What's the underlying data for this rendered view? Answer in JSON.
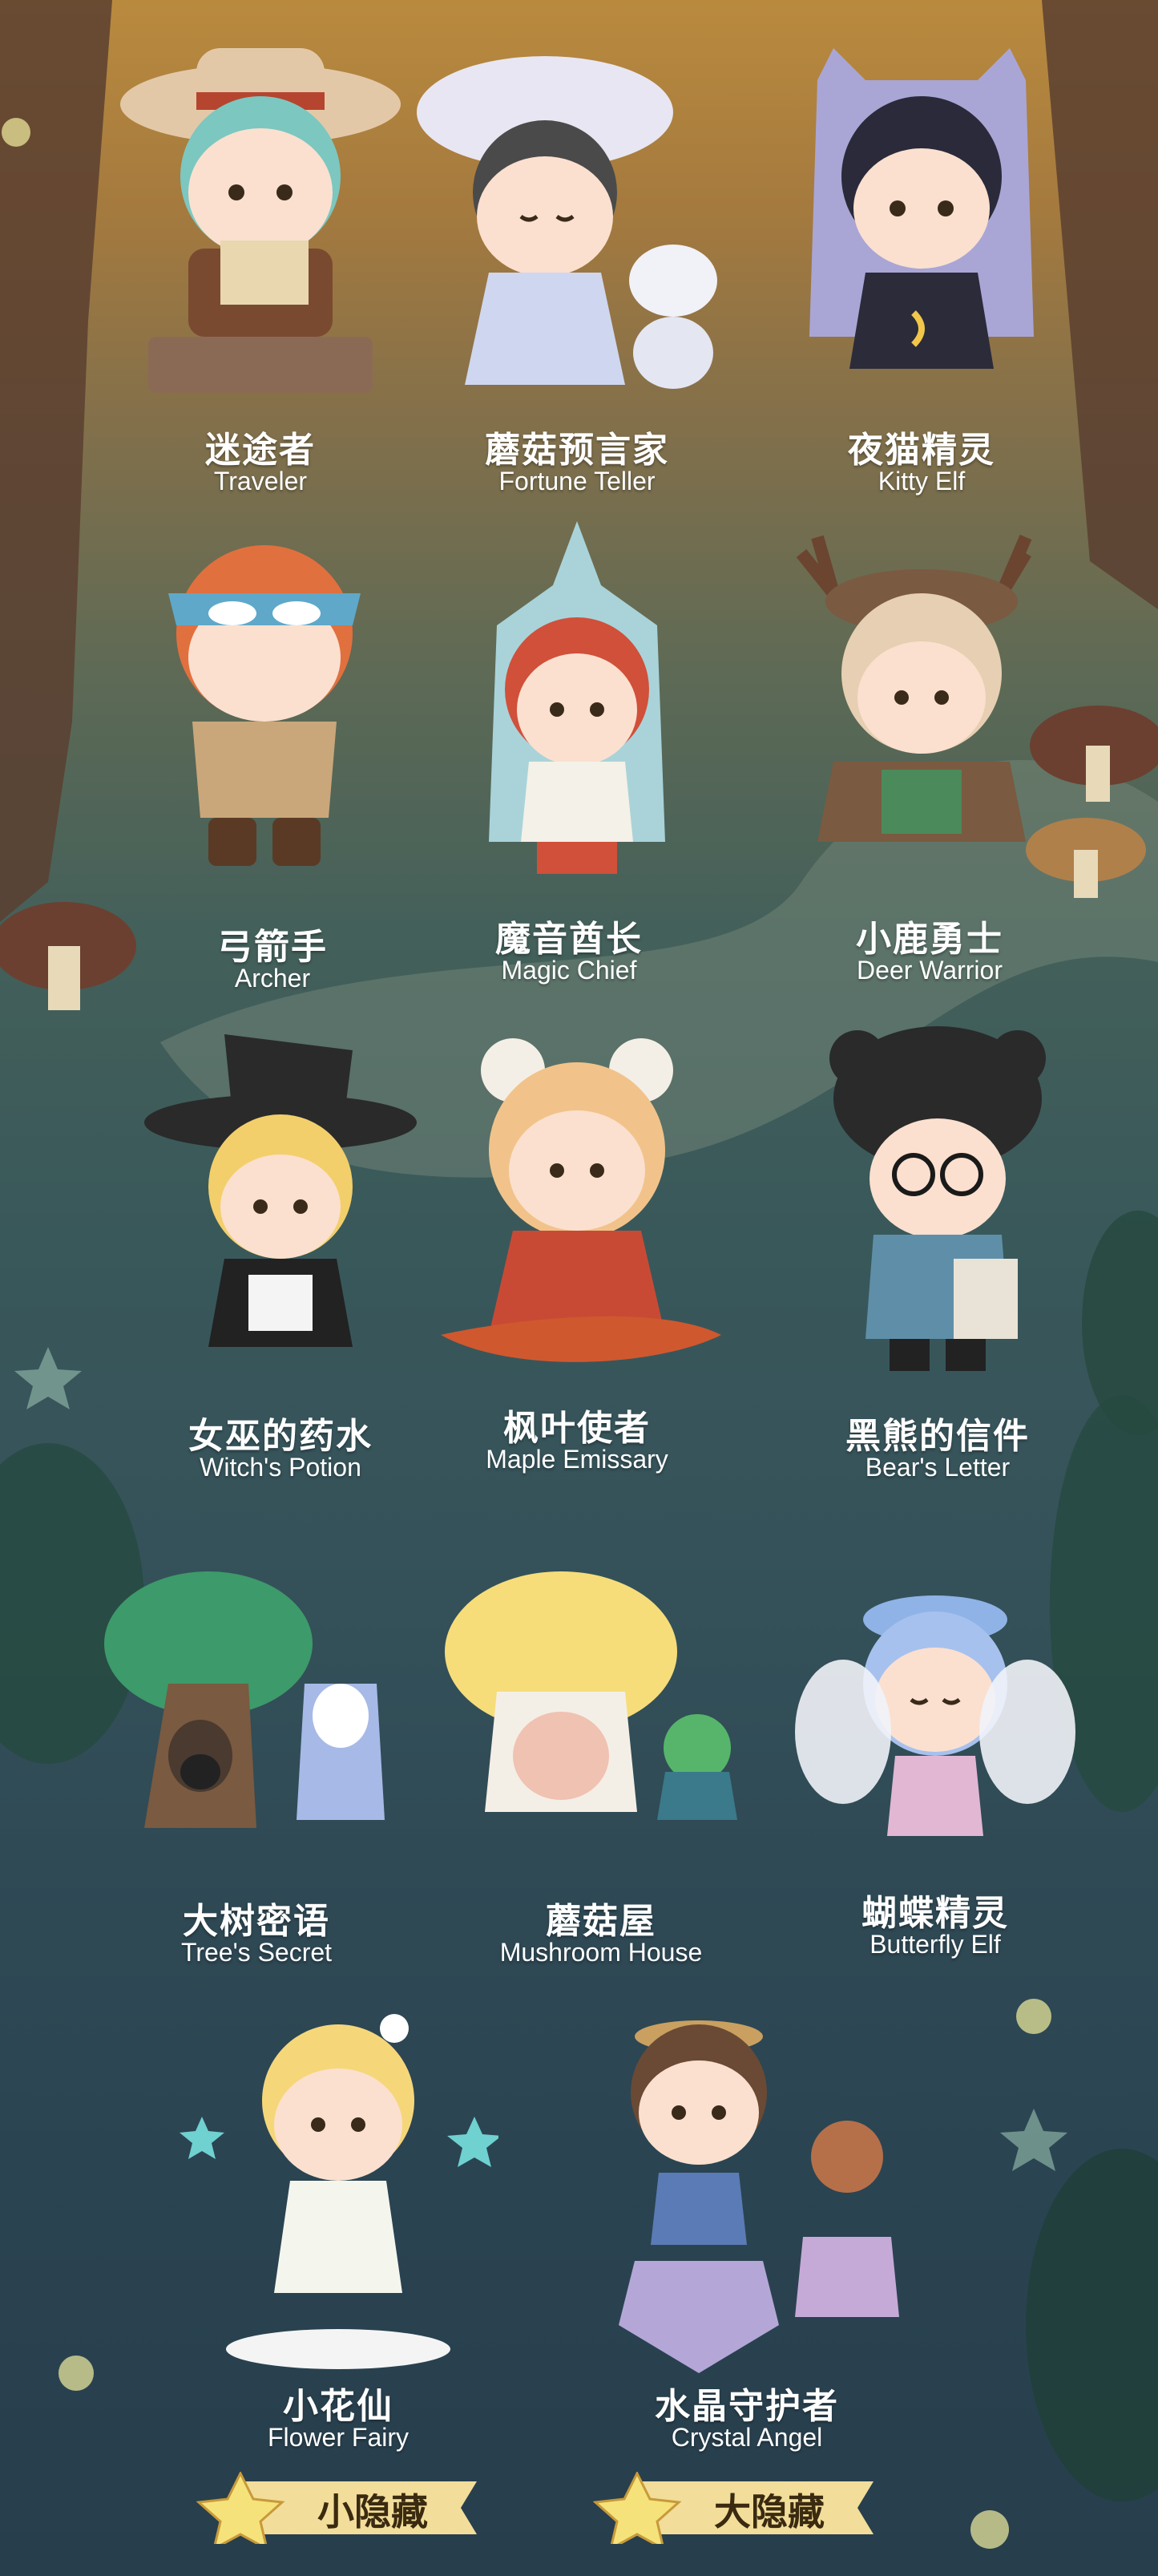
{
  "theme": {
    "label_color": "#ffffff",
    "badge_color": "#f2dd9a",
    "badge_star_color": "#f6e27a"
  },
  "figures": [
    {
      "cn": "迷途者",
      "en": "Traveler",
      "icon": "traveler-figure-icon"
    },
    {
      "cn": "蘑菇预言家",
      "en": "Fortune Teller",
      "icon": "fortune-teller-figure-icon"
    },
    {
      "cn": "夜猫精灵",
      "en": "Kitty Elf",
      "icon": "kitty-elf-figure-icon"
    },
    {
      "cn": "弓箭手",
      "en": "Archer",
      "icon": "archer-figure-icon"
    },
    {
      "cn": "魔音酋长",
      "en": "Magic Chief",
      "icon": "magic-chief-figure-icon"
    },
    {
      "cn": "小鹿勇士",
      "en": "Deer Warrior",
      "icon": "deer-warrior-figure-icon"
    },
    {
      "cn": "女巫的药水",
      "en": "Witch's Potion",
      "icon": "witch-potion-figure-icon"
    },
    {
      "cn": "枫叶使者",
      "en": "Maple Emissary",
      "icon": "maple-emissary-figure-icon"
    },
    {
      "cn": "黑熊的信件",
      "en": "Bear's Letter",
      "icon": "bear-letter-figure-icon"
    },
    {
      "cn": "大树密语",
      "en": "Tree's Secret",
      "icon": "tree-secret-figure-icon"
    },
    {
      "cn": "蘑菇屋",
      "en": "Mushroom House",
      "icon": "mushroom-house-figure-icon"
    },
    {
      "cn": "蝴蝶精灵",
      "en": "Butterfly Elf",
      "icon": "butterfly-elf-figure-icon"
    },
    {
      "cn": "小花仙",
      "en": "Flower Fairy",
      "icon": "flower-fairy-figure-icon"
    },
    {
      "cn": "水晶守护者",
      "en": "Crystal Angel",
      "icon": "crystal-angel-figure-icon"
    }
  ],
  "badges": {
    "small_secret": "小隐藏",
    "big_secret": "大隐藏"
  }
}
